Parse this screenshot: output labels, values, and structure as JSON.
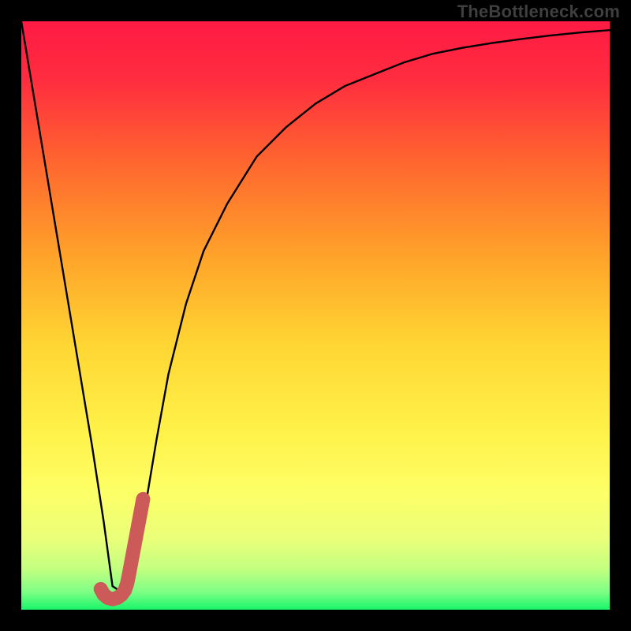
{
  "watermark": {
    "text": "TheBottleneck.com"
  },
  "colors": {
    "background": "#000000",
    "gradient_stops": [
      {
        "offset": 0.0,
        "color": "#ff1a44"
      },
      {
        "offset": 0.1,
        "color": "#ff2d3f"
      },
      {
        "offset": 0.25,
        "color": "#ff6a2e"
      },
      {
        "offset": 0.4,
        "color": "#ffa32a"
      },
      {
        "offset": 0.55,
        "color": "#ffd633"
      },
      {
        "offset": 0.7,
        "color": "#fff24a"
      },
      {
        "offset": 0.8,
        "color": "#fdff66"
      },
      {
        "offset": 0.88,
        "color": "#eaff7a"
      },
      {
        "offset": 0.93,
        "color": "#c4ff80"
      },
      {
        "offset": 0.97,
        "color": "#7dff85"
      },
      {
        "offset": 1.0,
        "color": "#18f56a"
      }
    ],
    "curve": "#000000",
    "marker": "#cc5a58"
  },
  "chart_data": {
    "type": "line",
    "title": "",
    "xlabel": "",
    "ylabel": "",
    "xlim": [
      0,
      100
    ],
    "ylim": [
      0,
      100
    ],
    "series": [
      {
        "name": "curve",
        "x": [
          0,
          2,
          4,
          6,
          8,
          10,
          12,
          14,
          15.5,
          17,
          19,
          21,
          23,
          25,
          28,
          31,
          35,
          40,
          45,
          50,
          55,
          60,
          65,
          70,
          75,
          80,
          85,
          90,
          95,
          100
        ],
        "y": [
          100,
          88,
          76,
          64,
          52,
          40,
          28,
          15,
          4,
          3,
          7,
          17,
          29,
          40,
          52,
          61,
          69,
          77,
          82,
          86,
          89,
          91,
          93,
          94.5,
          95.5,
          96.3,
          97,
          97.6,
          98.1,
          98.5
        ]
      }
    ],
    "marker": {
      "name": "J-marker",
      "x": [
        13.5,
        14.0,
        14.7,
        15.5,
        16.3,
        17.0,
        17.6,
        18.0,
        18.3,
        18.6,
        18.9,
        19.2,
        19.5,
        19.8,
        20.1,
        20.4,
        20.7
      ],
      "y": [
        3.5,
        2.6,
        2.0,
        1.8,
        2.0,
        2.5,
        3.3,
        4.5,
        6.0,
        7.6,
        9.2,
        10.8,
        12.4,
        14.0,
        15.6,
        17.2,
        18.8
      ]
    }
  }
}
